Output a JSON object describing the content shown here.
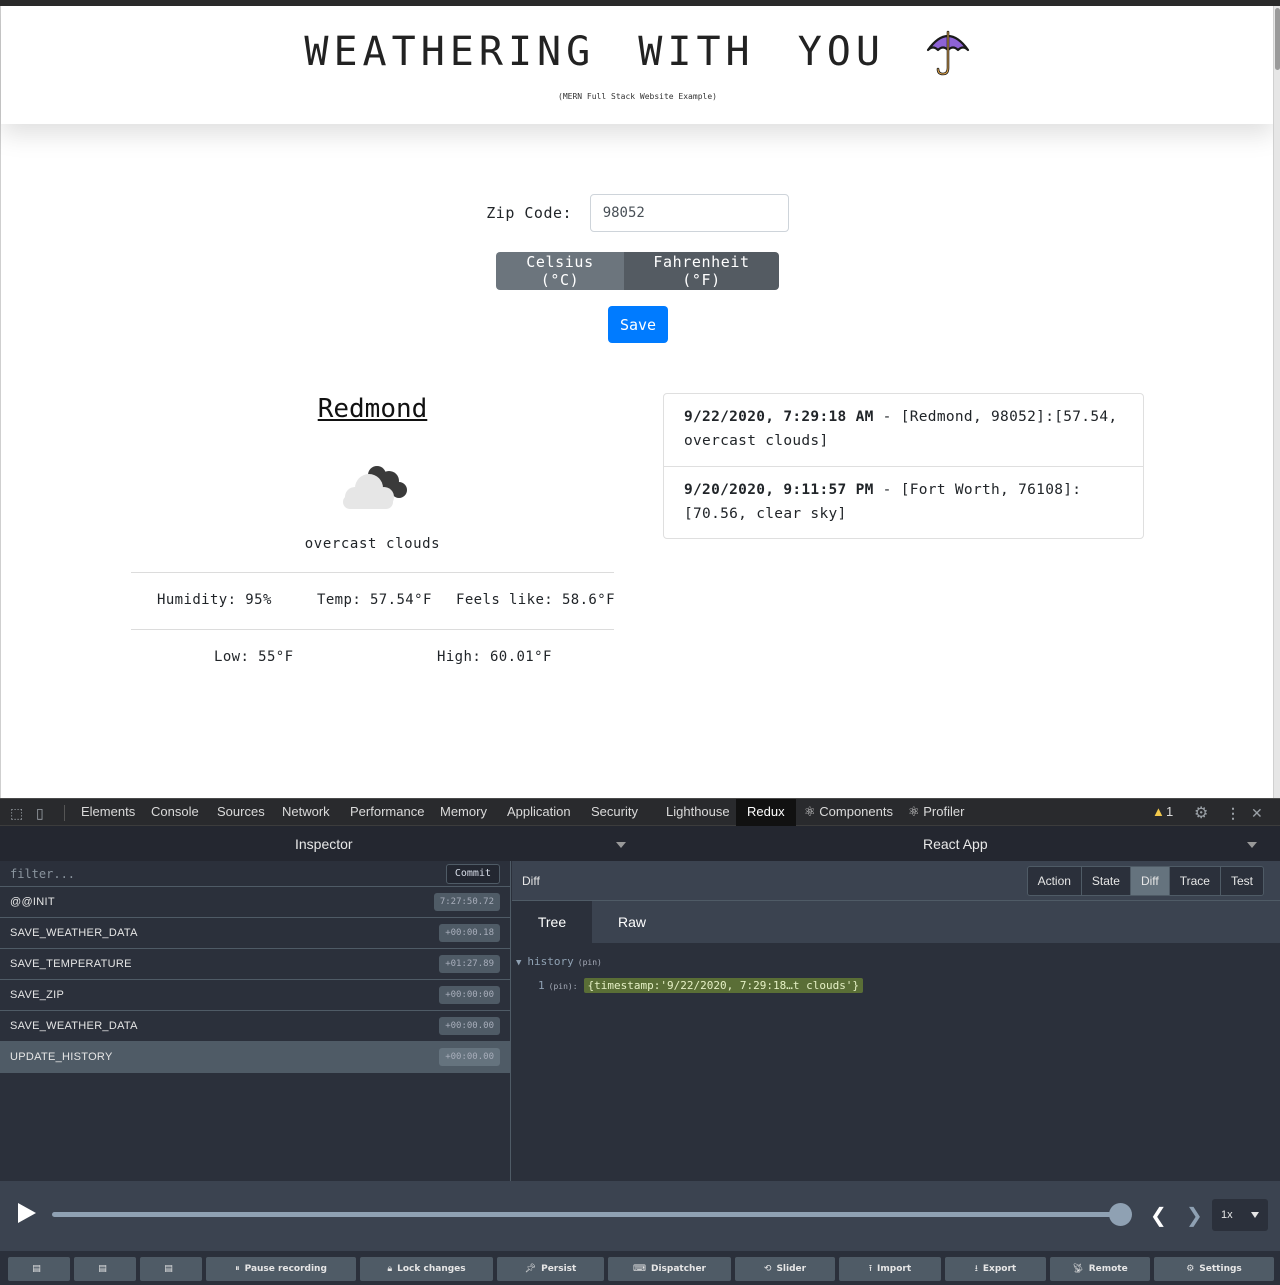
{
  "header": {
    "title": "WEATHERING WITH YOU",
    "subtitle": "(MERN Full Stack Website Example)",
    "logo_icon": "umbrella-icon"
  },
  "form": {
    "zip_label": "Zip Code:",
    "zip_value": "98052",
    "unit_celsius": "Celsius (°C)",
    "unit_fahrenheit": "Fahrenheit (°F)",
    "save_label": "Save",
    "save_color": "#007bff"
  },
  "weather": {
    "city": "Redmond",
    "icon": "cloud-icon",
    "description": "overcast clouds",
    "humidity": "Humidity: 95%",
    "temp": "Temp: 57.54°F",
    "feels_like": "Feels like: 58.6°F",
    "low": "Low: 55°F",
    "high": "High: 60.01°F"
  },
  "history": [
    {
      "timestamp": "9/22/2020, 7:29:18 AM",
      "text": " - [Redmond, 98052]:[57.54, overcast clouds]"
    },
    {
      "timestamp": "9/20/2020, 9:11:57 PM",
      "text": " - [Fort Worth, 76108]:[70.56, clear sky]"
    }
  ],
  "devtools": {
    "tabs": [
      "Elements",
      "Console",
      "Sources",
      "Network",
      "Performance",
      "Memory",
      "Application",
      "Security",
      "Lighthouse",
      "Redux",
      "⚛ Components",
      "⚛ Profiler"
    ],
    "active_tab": "Redux",
    "warning_count": "1",
    "inspector_label": "Inspector",
    "app_label": "React App",
    "filter_placeholder": "filter...",
    "commit_label": "Commit",
    "actions": [
      {
        "name": "@@INIT",
        "time": "7:27:50.72"
      },
      {
        "name": "SAVE_WEATHER_DATA",
        "time": "+00:00.18"
      },
      {
        "name": "SAVE_TEMPERATURE",
        "time": "+01:27.89"
      },
      {
        "name": "SAVE_ZIP",
        "time": "+00:00:00"
      },
      {
        "name": "SAVE_WEATHER_DATA",
        "time": "+00:00.00"
      },
      {
        "name": "UPDATE_HISTORY",
        "time": "+00:00.00"
      }
    ],
    "selected_action": "UPDATE_HISTORY",
    "diff_label": "Diff",
    "monitor_buttons": [
      "Action",
      "State",
      "Diff",
      "Trace",
      "Test"
    ],
    "active_monitor": "Diff",
    "view_tabs": [
      "Tree",
      "Raw"
    ],
    "active_view": "Tree",
    "tree": {
      "key": "history",
      "pin": "(pin)",
      "index": "1",
      "index_pin": "(pin):",
      "value": "{timestamp:'9/22/2020, 7:29:18…t clouds'}"
    },
    "player": {
      "speed": "1x",
      "slider_position": 1.0
    },
    "bottom_buttons": [
      {
        "label": "",
        "icon": "layout-left-icon"
      },
      {
        "label": "",
        "icon": "layout-right-icon"
      },
      {
        "label": "",
        "icon": "layout-bottom-icon"
      },
      {
        "label": "Pause recording",
        "icon": "pause-icon"
      },
      {
        "label": "Lock changes",
        "icon": "lock-icon"
      },
      {
        "label": "Persist",
        "icon": "pin-icon"
      },
      {
        "label": "Dispatcher",
        "icon": "keyboard-icon"
      },
      {
        "label": "Slider",
        "icon": "history-icon"
      },
      {
        "label": "Import",
        "icon": "upload-icon"
      },
      {
        "label": "Export",
        "icon": "download-icon"
      },
      {
        "label": "Remote",
        "icon": "antenna-icon"
      },
      {
        "label": "Settings",
        "icon": "gear-icon"
      }
    ]
  }
}
